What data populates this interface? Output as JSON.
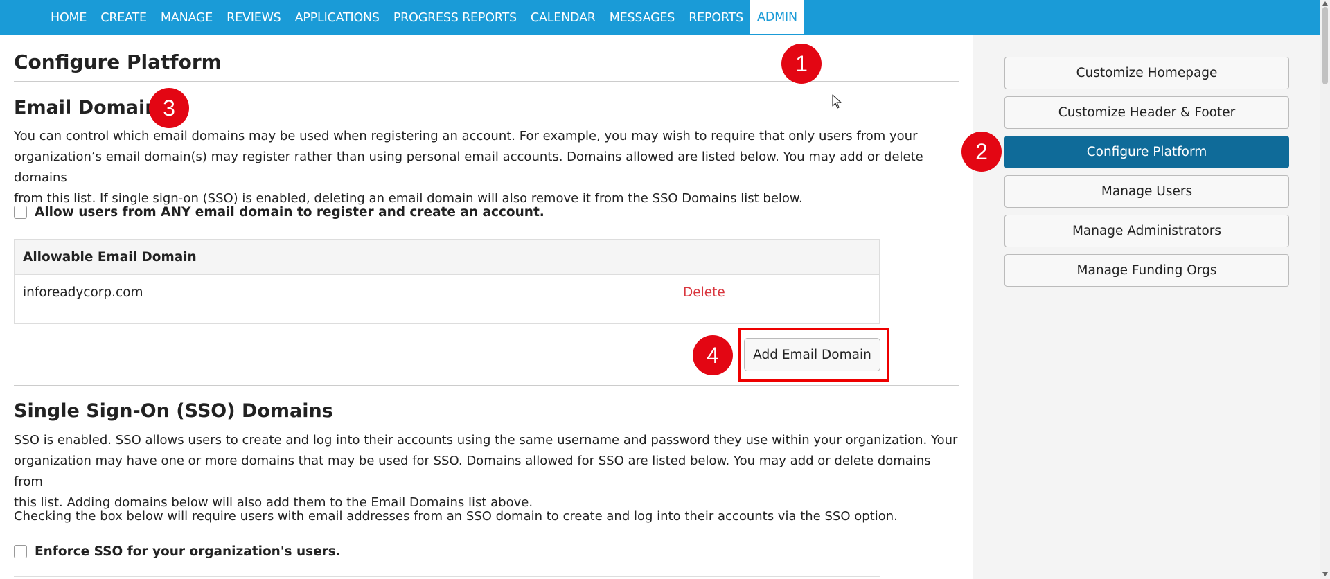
{
  "nav": {
    "items": [
      {
        "label": "HOME"
      },
      {
        "label": "CREATE"
      },
      {
        "label": "MANAGE"
      },
      {
        "label": "REVIEWS"
      },
      {
        "label": "APPLICATIONS"
      },
      {
        "label": "PROGRESS REPORTS"
      },
      {
        "label": "CALENDAR"
      },
      {
        "label": "MESSAGES"
      },
      {
        "label": "REPORTS"
      },
      {
        "label": "ADMIN"
      }
    ],
    "active": "ADMIN"
  },
  "page": {
    "title": "Configure Platform"
  },
  "email_domains": {
    "heading": "Email Domains",
    "description_line1": "You can control which email domains may be used when registering an account. For example, you may wish to require that only users from your",
    "description_line2": "organization’s email domain(s) may register rather than using personal email accounts. Domains allowed are listed below. You may add or delete domains",
    "description_line3": "from this list. If single sign-on (SSO) is enabled, deleting an email domain will also remove it from the SSO Domains list below.",
    "allow_any_label": "Allow users from ANY email domain to register and create an account.",
    "allow_any_checked": false,
    "table_header": "Allowable Email Domain",
    "rows": [
      {
        "domain": "inforeadycorp.com",
        "action": "Delete"
      }
    ],
    "add_button": "Add Email Domain"
  },
  "sso": {
    "heading": "Single Sign-On (SSO) Domains",
    "description_line1": "SSO is enabled. SSO allows users to create and log into their accounts using the same username and password they use within your organization. Your",
    "description_line2": "organization may have one or more domains that may be used for SSO. Domains allowed for SSO are listed below. You may add or delete domains from",
    "description_line3": "this list. Adding domains below will also add them to the Email Domains list above.",
    "enforce_note": "Checking the box below will require users with email addresses from an SSO domain to create and log into their accounts via the SSO option.",
    "enforce_label": "Enforce SSO for your organization's users.",
    "enforce_checked": false
  },
  "sidebar": {
    "buttons": [
      {
        "label": "Customize Homepage"
      },
      {
        "label": "Customize Header & Footer"
      },
      {
        "label": "Configure Platform"
      },
      {
        "label": "Manage Users"
      },
      {
        "label": "Manage Administrators"
      },
      {
        "label": "Manage Funding Orgs"
      }
    ],
    "active": "Configure Platform"
  },
  "markers": [
    "1",
    "2",
    "3",
    "4"
  ],
  "colors": {
    "nav_bg": "#1a9bd7",
    "active_sidebar": "#0f6b99",
    "delete": "#d9363e",
    "marker": "#e30613",
    "highlight_box": "#e00000"
  }
}
